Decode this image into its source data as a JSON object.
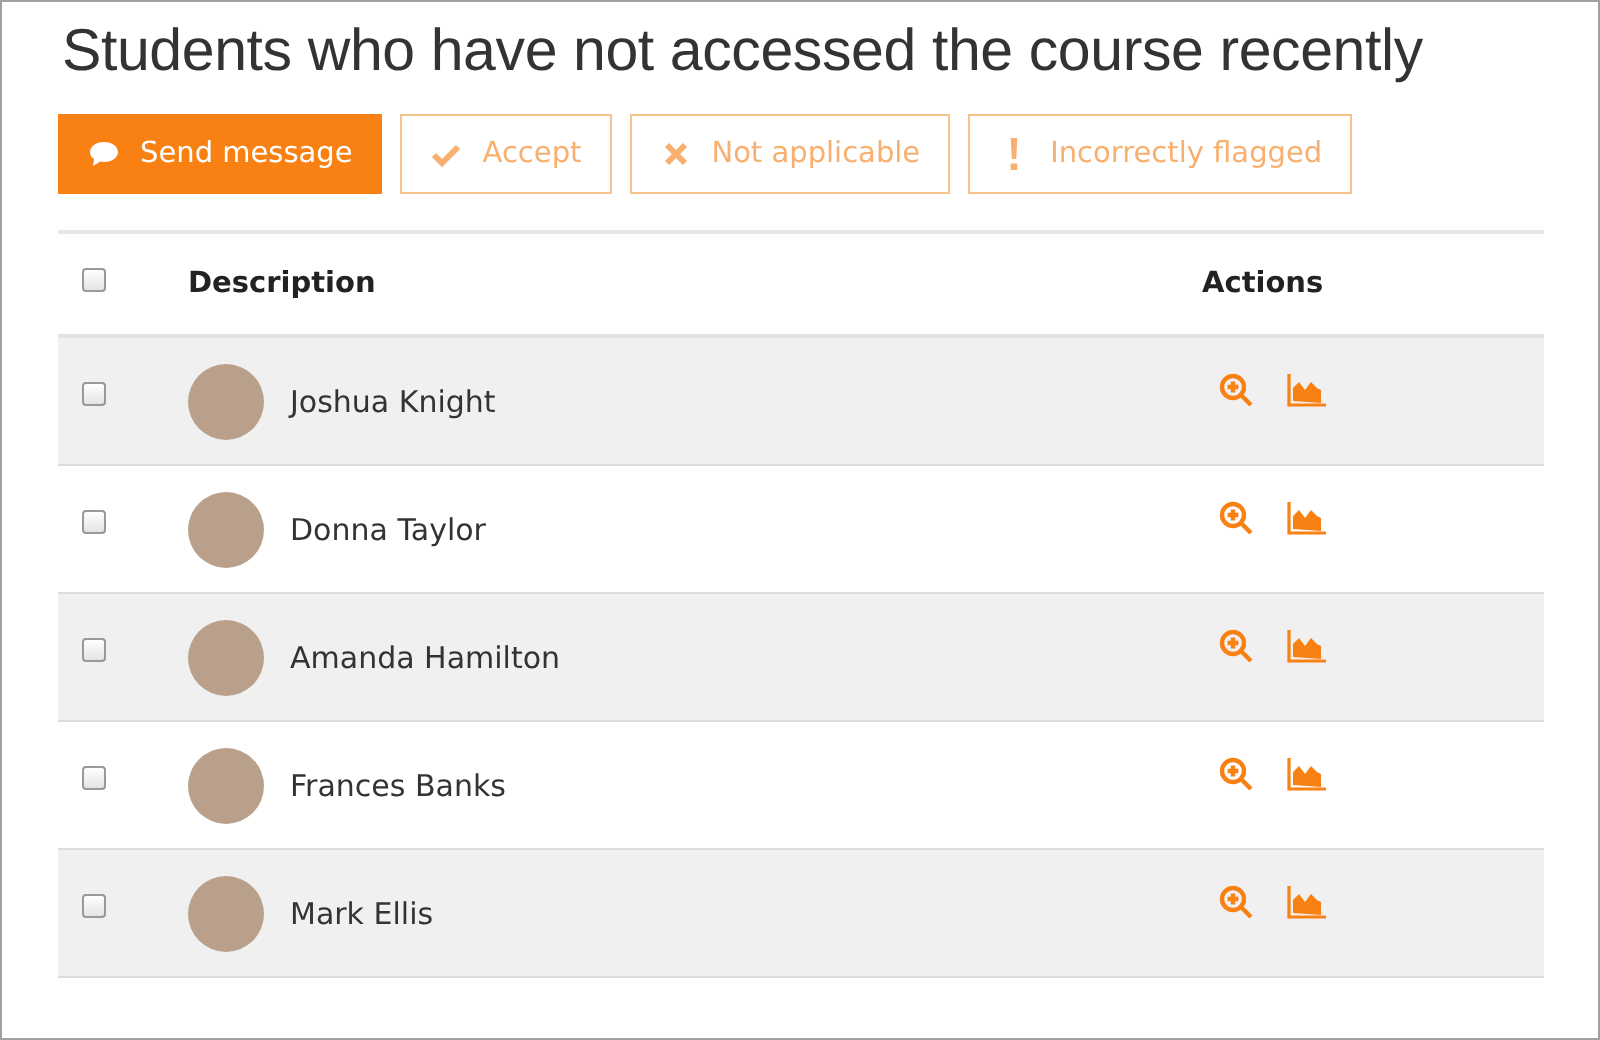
{
  "title": "Students who have not accessed the course recently",
  "buttons": [
    {
      "kind": "primary",
      "label": "Send message"
    },
    {
      "kind": "outline",
      "label": "Accept"
    },
    {
      "kind": "outline",
      "label": "Not applicable"
    },
    {
      "kind": "outline",
      "label": "Incorrectly flagged"
    }
  ],
  "table": {
    "select_all": {
      "checked": false
    },
    "columns": [
      "Description",
      "Actions"
    ],
    "rows": [
      {
        "name": "Joshua Knight",
        "checked": false
      },
      {
        "name": "Donna Taylor",
        "checked": false
      },
      {
        "name": "Amanda Hamilton",
        "checked": false
      },
      {
        "name": "Frances Banks",
        "checked": false
      },
      {
        "name": "Mark Ellis",
        "checked": false
      }
    ]
  }
}
